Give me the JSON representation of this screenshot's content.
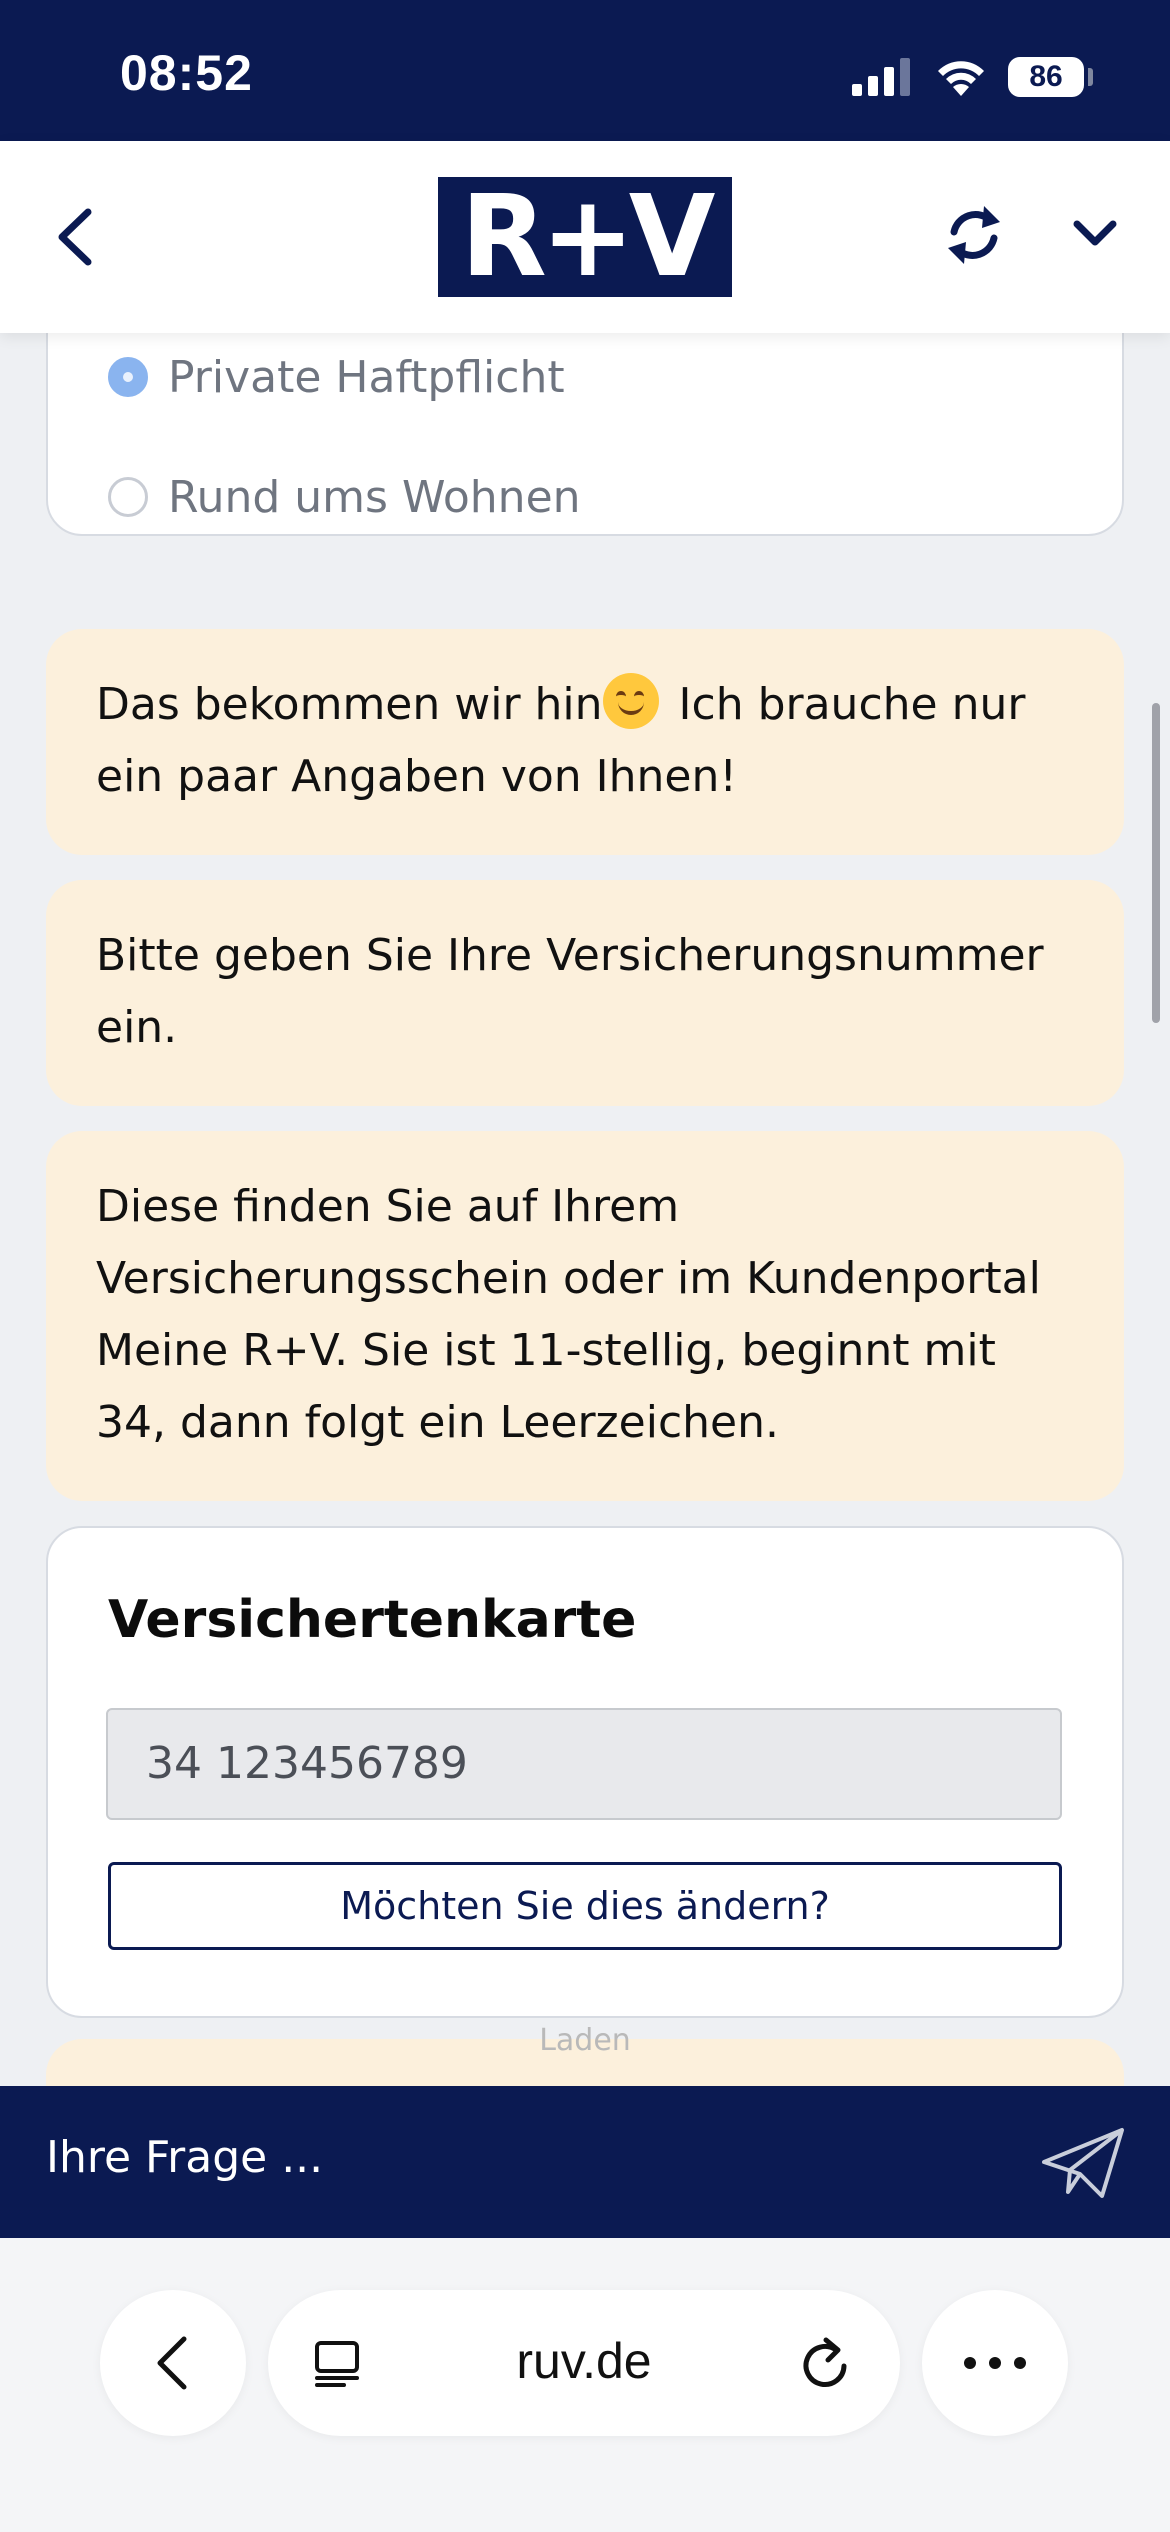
{
  "status_bar": {
    "time": "08:52",
    "battery": "86"
  },
  "header": {
    "logo": "R+V",
    "brand_color": "#0b1a52"
  },
  "radio_options": [
    {
      "label": "Private Haftpflicht",
      "selected": true
    },
    {
      "label": "Rund ums Wohnen",
      "selected": false
    }
  ],
  "messages": [
    {
      "text_before_emoji": "Das bekommen wir hin",
      "text_after_emoji": " Ich brauche nur ein paar Angaben von Ihnen!",
      "emoji": "smiling-face"
    },
    {
      "text": "Bitte geben Sie Ihre Versicherungsnummer ein."
    },
    {
      "text": "Diese finden Sie auf Ihrem Versicherungsschein oder im Kundenportal Meine R+V. Sie ist 11-stellig, beginnt mit 34, dann folgt ein Leerzeichen."
    }
  ],
  "card": {
    "title": "Versichertenkarte",
    "input_value": "34 123456789",
    "button_label": "Möchten Sie dies ändern?"
  },
  "typing_indicator": "Laden",
  "chat_input": {
    "placeholder": "Ihre Frage ..."
  },
  "browser": {
    "url": "ruv.de"
  },
  "colors": {
    "navy": "#0b1a52",
    "bubble": "#fcf0dc",
    "radio_selected": "#8ab4ef"
  }
}
